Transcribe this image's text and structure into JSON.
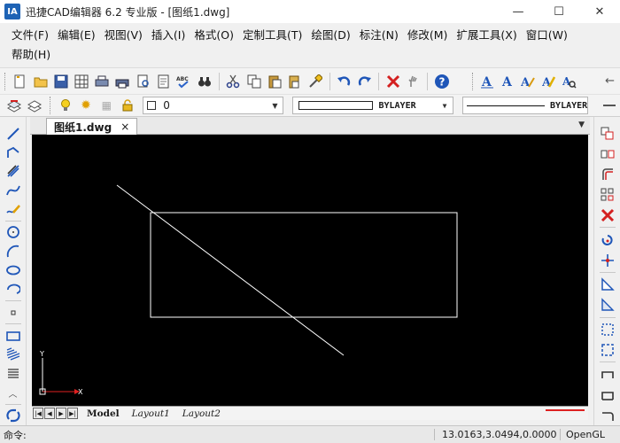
{
  "window": {
    "app_icon_text": "IA",
    "title": "迅捷CAD编辑器 6.2 专业版  - [图纸1.dwg]",
    "controls": {
      "minimize": "—",
      "maximize": "☐",
      "close": "✕"
    }
  },
  "menu": [
    {
      "id": "file",
      "label": "文件(F)"
    },
    {
      "id": "edit",
      "label": "编辑(E)"
    },
    {
      "id": "view",
      "label": "视图(V)"
    },
    {
      "id": "insert",
      "label": "插入(I)"
    },
    {
      "id": "format",
      "label": "格式(O)"
    },
    {
      "id": "custom-tools",
      "label": "定制工具(T)"
    },
    {
      "id": "draw",
      "label": "绘图(D)"
    },
    {
      "id": "annotate",
      "label": "标注(N)"
    },
    {
      "id": "modify",
      "label": "修改(M)"
    },
    {
      "id": "ext-tools",
      "label": "扩展工具(X)"
    },
    {
      "id": "window",
      "label": "窗口(W)"
    },
    {
      "id": "help",
      "label": "帮助(H)"
    }
  ],
  "toolbar": {
    "abc_label": "ABC",
    "binocular": "🔭",
    "right_arrow": "←"
  },
  "props": {
    "layer_name": "0",
    "color_name": "BYLAYER",
    "linetype_name": "BYLAYER",
    "combo_arrow": "▼"
  },
  "document": {
    "tab_label": "图纸1.dwg",
    "close_glyph": "×",
    "dropdown_glyph": "▼"
  },
  "ucs": {
    "y_label": "Y",
    "x_label": "X"
  },
  "layout_tabs": [
    {
      "id": "model",
      "label": "Model"
    },
    {
      "id": "layout1",
      "label": "Layout1"
    },
    {
      "id": "layout2",
      "label": "Layout2"
    }
  ],
  "layout_nav": {
    "first": "|◀",
    "prev": "◀",
    "next": "▶",
    "last": "▶|"
  },
  "status": {
    "command_label": "命令:",
    "coordinates": "13.0163,3.0494,0.0000",
    "renderer": "OpenGL"
  },
  "colors": {
    "canvas_bg": "#000000",
    "entity": "#ffffff",
    "ucs_x_axis": "#e02020",
    "ucs_y_axis": "#ffffff"
  }
}
